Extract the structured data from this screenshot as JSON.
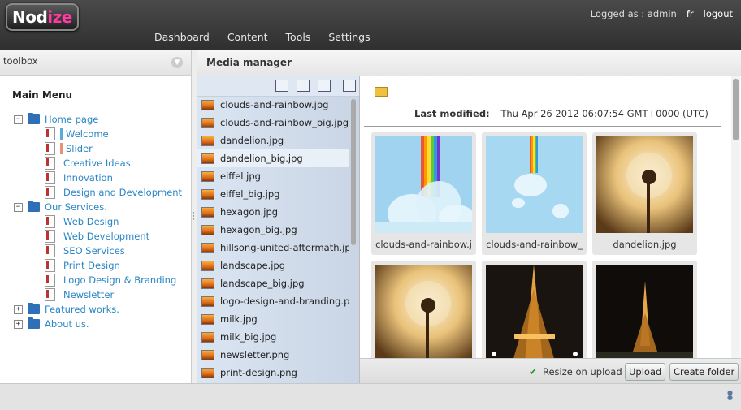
{
  "header": {
    "logo": {
      "prefix": "Nod",
      "accent": "ize"
    },
    "nav": [
      "Dashboard",
      "Content",
      "Tools",
      "Settings"
    ],
    "logged_as": "Logged as : admin",
    "lang": "fr",
    "logout": "logout"
  },
  "left_panel": {
    "title": "toolbox",
    "menu_title": "Main Menu",
    "tree": [
      {
        "label": "Home page",
        "type": "folder-open",
        "level": 0,
        "toggle": "−"
      },
      {
        "label": "Welcome",
        "type": "page",
        "level": 1,
        "marker": "#5aa9d8"
      },
      {
        "label": "Slider",
        "type": "page",
        "level": 1,
        "marker": "#e8907a"
      },
      {
        "label": "Creative Ideas",
        "type": "page",
        "level": 1
      },
      {
        "label": "Innovation",
        "type": "page",
        "level": 1
      },
      {
        "label": "Design and Development",
        "type": "page",
        "level": 1
      },
      {
        "label": "Our Services.",
        "type": "folder-open",
        "level": 0,
        "toggle": "−"
      },
      {
        "label": "Web Design",
        "type": "page",
        "level": 1
      },
      {
        "label": "Web Development",
        "type": "page",
        "level": 1
      },
      {
        "label": "SEO Services",
        "type": "page",
        "level": 1
      },
      {
        "label": "Print Design",
        "type": "page",
        "level": 1
      },
      {
        "label": "Logo Design & Branding",
        "type": "page",
        "level": 1
      },
      {
        "label": "Newsletter",
        "type": "page",
        "level": 1
      },
      {
        "label": "Featured works.",
        "type": "folder",
        "level": 0,
        "toggle": "+"
      },
      {
        "label": "About us.",
        "type": "folder",
        "level": 0,
        "toggle": "+"
      }
    ]
  },
  "media_manager": {
    "title": "Media manager",
    "files": [
      "clouds-and-rainbow.jpg",
      "clouds-and-rainbow_big.jpg",
      "dandelion.jpg",
      "dandelion_big.jpg",
      "eiffel.jpg",
      "eiffel_big.jpg",
      "hexagon.jpg",
      "hexagon_big.jpg",
      "hillsong-united-aftermath.jp",
      "landscape.jpg",
      "landscape_big.jpg",
      "logo-design-and-branding.p",
      "milk.jpg",
      "milk_big.jpg",
      "newsletter.png",
      "print-design.png"
    ],
    "active_file": "dandelion_big.jpg",
    "last_modified_label": "Last modified:",
    "last_modified_value": "Thu Apr 26 2012 06:07:54 GMT+0000 (UTC)",
    "thumbnails": [
      {
        "caption": "clouds-and-rainbow.j",
        "kind": "rainbow"
      },
      {
        "caption": "clouds-and-rainbow_",
        "kind": "rainbow-small"
      },
      {
        "caption": "dandelion.jpg",
        "kind": "dandelion"
      },
      {
        "caption": "",
        "kind": "dandelion"
      },
      {
        "caption": "",
        "kind": "eiffel-close"
      },
      {
        "caption": "",
        "kind": "eiffel-far"
      }
    ],
    "resize_label": "Resize on upload",
    "upload_button": "Upload",
    "create_folder_button": "Create folder"
  }
}
